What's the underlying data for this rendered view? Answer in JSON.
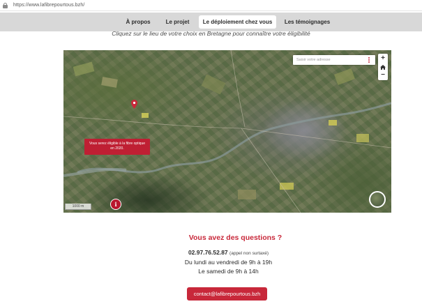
{
  "browser": {
    "url": "https://www.lafibrepourtous.bzh/"
  },
  "nav": {
    "items": [
      {
        "label": "À propos",
        "active": false
      },
      {
        "label": "Le projet",
        "active": false
      },
      {
        "label": "Le déploiement chez vous",
        "active": true
      },
      {
        "label": "Les témoignages",
        "active": false
      }
    ]
  },
  "subtitle": "Cliquez sur le lieu de votre choix en Bretagne pour connaître votre éligibilité",
  "map": {
    "search_placeholder": "Saisir votre adresse",
    "zoom_in_label": "+",
    "zoom_out_label": "−",
    "popup_line1": "Vous serez éligible à la fibre optique",
    "popup_line2": "en 2020.",
    "scale_label": "1000 m",
    "info_label": "i",
    "marker_color": "#c8283a"
  },
  "contact": {
    "title": "Vous avez des questions ?",
    "phone": "02.97.76.52.87",
    "phone_note": "(appel non surtaxé)",
    "hours_weekday": "Du lundi au vendredi de 9h à 19h",
    "hours_saturday": "Le samedi de 9h à 14h",
    "email_button": "contact@lafibrepourtous.bzh"
  },
  "colors": {
    "brand_red": "#c8283a",
    "nav_background": "#d8d8d8"
  }
}
